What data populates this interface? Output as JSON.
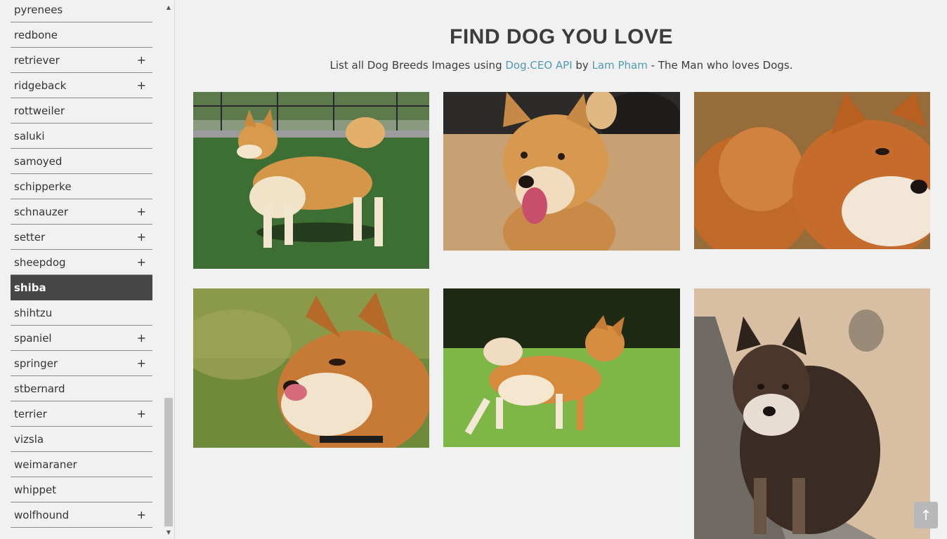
{
  "sidebar": {
    "breeds": [
      {
        "label": "pyrenees",
        "expand": ""
      },
      {
        "label": "redbone",
        "expand": ""
      },
      {
        "label": "retriever",
        "expand": "+"
      },
      {
        "label": "ridgeback",
        "expand": "+"
      },
      {
        "label": "rottweiler",
        "expand": ""
      },
      {
        "label": "saluki",
        "expand": ""
      },
      {
        "label": "samoyed",
        "expand": ""
      },
      {
        "label": "schipperke",
        "expand": ""
      },
      {
        "label": "schnauzer",
        "expand": "+"
      },
      {
        "label": "setter",
        "expand": "+"
      },
      {
        "label": "sheepdog",
        "expand": "+"
      },
      {
        "label": "shiba",
        "expand": ""
      },
      {
        "label": "shihtzu",
        "expand": ""
      },
      {
        "label": "spaniel",
        "expand": "+"
      },
      {
        "label": "springer",
        "expand": "+"
      },
      {
        "label": "stbernard",
        "expand": ""
      },
      {
        "label": "terrier",
        "expand": "+"
      },
      {
        "label": "vizsla",
        "expand": ""
      },
      {
        "label": "weimaraner",
        "expand": ""
      },
      {
        "label": "whippet",
        "expand": ""
      },
      {
        "label": "wolfhound",
        "expand": "+"
      }
    ],
    "active": "shiba"
  },
  "header": {
    "title": "FIND DOG YOU LOVE",
    "subtitle_prefix": "List all Dog Breeds Images using ",
    "api_link": "Dog.CEO API",
    "subtitle_by": " by ",
    "author_link": "Lam Pham",
    "subtitle_suffix": " - The Man who loves Dogs."
  },
  "gallery": {
    "photos": [
      {
        "name": "shiba-photo-1",
        "scene": "grass"
      },
      {
        "name": "shiba-photo-2",
        "scene": "dirt"
      },
      {
        "name": "shiba-photo-3",
        "scene": "closeup"
      },
      {
        "name": "shiba-photo-4",
        "scene": "grass-blur"
      },
      {
        "name": "shiba-photo-5",
        "scene": "lawn"
      },
      {
        "name": "shiba-photo-6",
        "scene": "sand"
      }
    ]
  },
  "back_to_top": {
    "icon": "arrow-up-icon",
    "glyph": "↑"
  },
  "colors": {
    "active_bg": "#464646",
    "link": "#4f9bb2",
    "background": "#f1f1f1"
  }
}
